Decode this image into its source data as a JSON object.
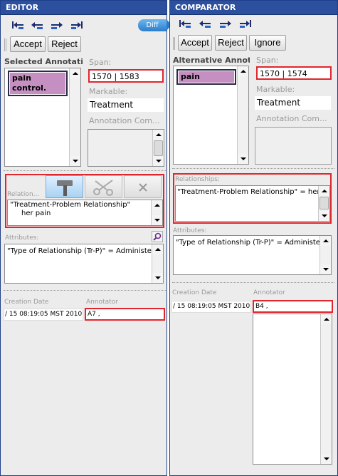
{
  "editor": {
    "title": "EDITOR",
    "toolbar_icons": [
      "first-annotation-icon",
      "previous-annotation-icon",
      "next-annotation-icon",
      "last-annotation-icon"
    ],
    "diff_label": "Diff",
    "accept_label": "Accept",
    "reject_label": "Reject",
    "selected_label": "Selected Annotatio",
    "selected_item": "pain control.",
    "span_label": "Span:",
    "span_value": "1570 | 1583",
    "markable_label": "Markable:",
    "markable_value": "Treatment",
    "annotation_comment_label": "Annotation Com...",
    "relation_label": "Relation...",
    "relationship_line1": "\"Treatment-Problem Relationship\"",
    "relationship_line2": "her pain",
    "attributes_label": "Attributes:",
    "attribute_value": "\"Type of Relationship (Tr-P)\" = Administered",
    "creation_date_label": "Creation Date",
    "annotator_label": "Annotator",
    "creation_date_value": "/ 15 08:19:05 MST 2010",
    "annotator_value": "A7 ,"
  },
  "comparator": {
    "title": "COMPARATOR",
    "toolbar_icons": [
      "first-annotation-icon",
      "previous-annotation-icon",
      "next-annotation-icon",
      "last-annotation-icon"
    ],
    "accept_label": "Accept",
    "reject_label": "Reject",
    "ignore_label": "Ignore",
    "alternative_label": "Alternative Annotat",
    "selected_item": "pain",
    "span_label": "Span:",
    "span_value": "1570 | 1574",
    "markable_label": "Markable:",
    "markable_value": "Treatment",
    "annotation_comment_label": "Annotation Com...",
    "relationships_label": "Relationships:",
    "relationship_value": "\"Treatment-Problem Relationship\" = her pa",
    "attributes_label": "Attributes:",
    "attribute_value": "\"Type of Relationship (Tr-P)\" = Administered",
    "creation_date_label": "Creation Date",
    "annotator_label": "Annotator",
    "creation_date_value": "/ 15 08:19:05 MST 2010",
    "annotator_value": "B4 ,"
  },
  "colors": {
    "title_bar": "#2c4f9e",
    "highlight_border": "#e0262d",
    "annotation_chip": "#c58fc2",
    "panel_background": "#ececec"
  }
}
